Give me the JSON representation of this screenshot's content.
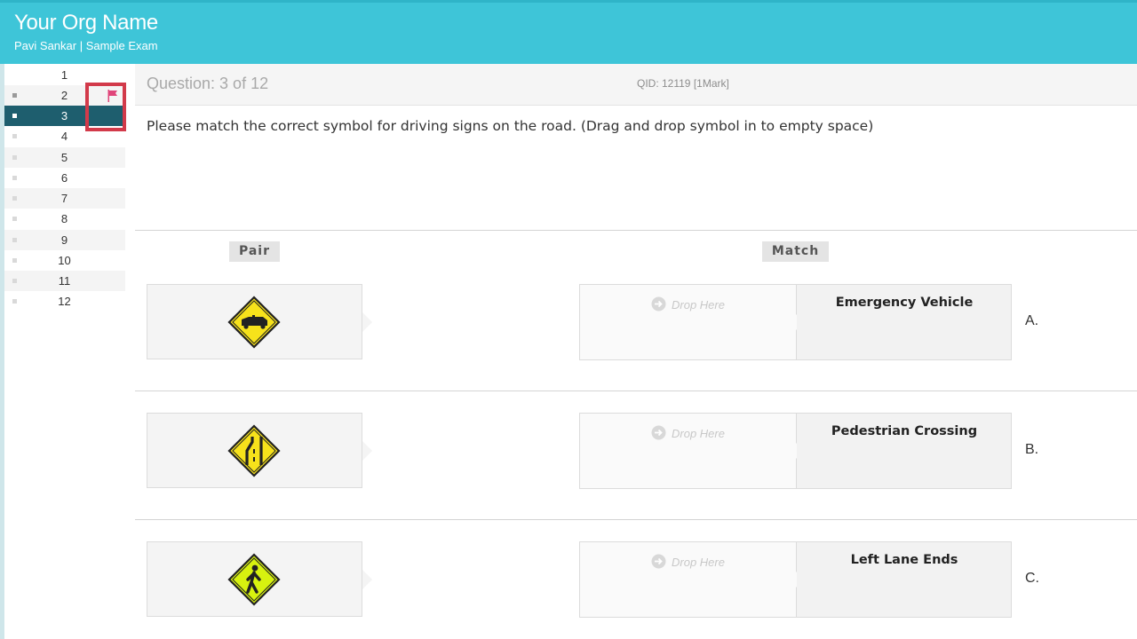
{
  "header": {
    "org_name": "Your Org Name",
    "subtitle": "Pavi Sankar | Sample Exam",
    "color": "#3ec5d8"
  },
  "sidebar": {
    "items": [
      {
        "label": "1",
        "state": "plain"
      },
      {
        "label": "2",
        "state": "attempted",
        "flagged": true
      },
      {
        "label": "3",
        "state": "current"
      },
      {
        "label": "4",
        "state": "plain"
      },
      {
        "label": "5",
        "state": "plain"
      },
      {
        "label": "6",
        "state": "plain"
      },
      {
        "label": "7",
        "state": "plain"
      },
      {
        "label": "8",
        "state": "plain"
      },
      {
        "label": "9",
        "state": "plain"
      },
      {
        "label": "10",
        "state": "plain"
      },
      {
        "label": "11",
        "state": "plain"
      },
      {
        "label": "12",
        "state": "plain"
      }
    ],
    "current_color": "#1e5e6e",
    "flag_color": "#e0457a",
    "highlight_color": "#d23a4a"
  },
  "question": {
    "counter": "Question: 3 of 12",
    "qid": "QID: 12119  [1Mark]",
    "text": "Please match the correct symbol for driving signs on the road. (Drag and drop symbol in to empty space)"
  },
  "columns": {
    "pair": "Pair",
    "match": "Match"
  },
  "pairs": [
    {
      "icon": "emergency-vehicle-sign-icon"
    },
    {
      "icon": "left-lane-ends-sign-icon"
    },
    {
      "icon": "pedestrian-crossing-sign-icon"
    }
  ],
  "drop_placeholder": "Drop Here",
  "matches": [
    {
      "title": "Emergency Vehicle",
      "letter": "A."
    },
    {
      "title": "Pedestrian Crossing",
      "letter": "B."
    },
    {
      "title": "Left Lane Ends",
      "letter": "C."
    }
  ],
  "colors": {
    "sign_yellow": "#f7e21b",
    "sign_lime": "#d7f20f"
  }
}
